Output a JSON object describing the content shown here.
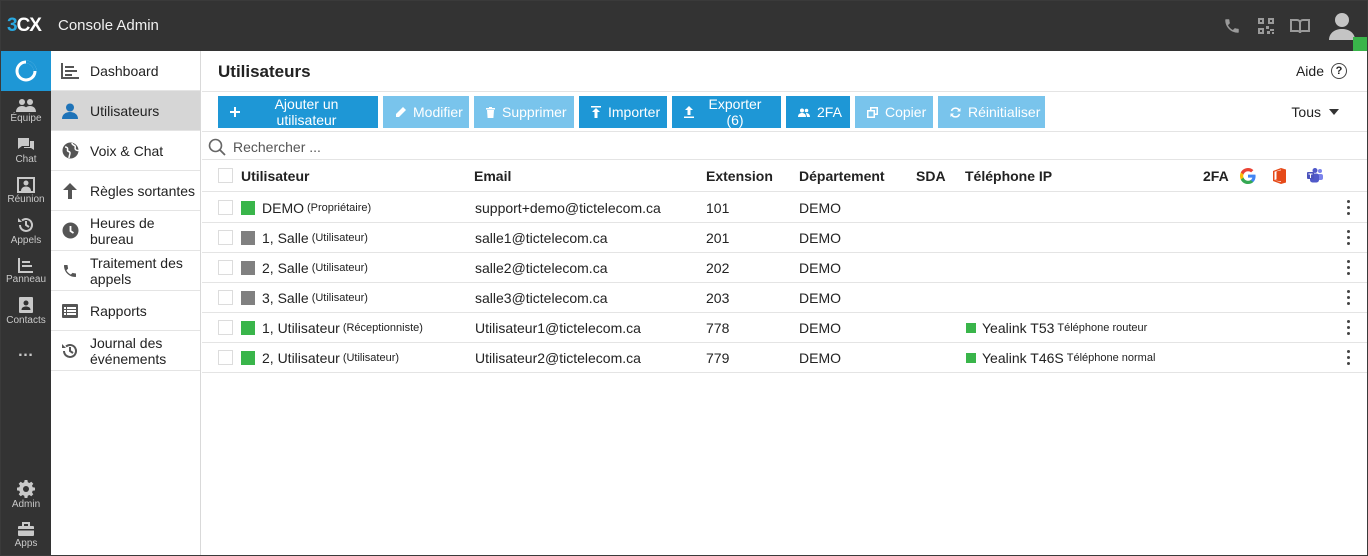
{
  "app": {
    "logo_part1": "3",
    "logo_part2": "CX",
    "title": "Console Admin"
  },
  "topbar_icons": [
    "phone-icon",
    "qr-code-icon",
    "book-icon",
    "user-avatar-icon"
  ],
  "rail": {
    "items": [
      {
        "label": "Équipe",
        "icon": "team-icon"
      },
      {
        "label": "Chat",
        "icon": "chat-icon"
      },
      {
        "label": "Réunion",
        "icon": "meeting-icon"
      },
      {
        "label": "Appels",
        "icon": "history-icon"
      },
      {
        "label": "Panneau",
        "icon": "panel-icon"
      },
      {
        "label": "Contacts",
        "icon": "contacts-icon"
      },
      {
        "label": "…",
        "icon": "more-icon"
      }
    ],
    "bottom": [
      {
        "label": "Admin",
        "icon": "gear-icon"
      },
      {
        "label": "Apps",
        "icon": "apps-icon"
      }
    ]
  },
  "menu": {
    "items": [
      {
        "label": "Dashboard",
        "icon": "dashboard-icon"
      },
      {
        "label": "Utilisateurs",
        "icon": "user-icon",
        "active": true
      },
      {
        "label": "Voix & Chat",
        "icon": "globe-icon"
      },
      {
        "label": "Règles sortantes",
        "icon": "arrow-up-icon"
      },
      {
        "label": "Heures de bureau",
        "icon": "clock-icon"
      },
      {
        "label": "Traitement des appels",
        "icon": "phone-icon"
      },
      {
        "label": "Rapports",
        "icon": "list-icon"
      },
      {
        "label": "Journal des événements",
        "icon": "history-icon"
      }
    ]
  },
  "main": {
    "title": "Utilisateurs",
    "help_label": "Aide",
    "help_glyph": "?",
    "toolbar": {
      "add": "Ajouter un utilisateur",
      "edit": "Modifier",
      "delete": "Supprimer",
      "import": "Importer",
      "export": "Exporter (6)",
      "twofa": "2FA",
      "copy": "Copier",
      "reset": "Réinitialiser"
    },
    "filter": "Tous",
    "search_placeholder": "Rechercher ...",
    "columns": {
      "user": "Utilisateur",
      "email": "Email",
      "extension": "Extension",
      "department": "Département",
      "sda": "SDA",
      "ip_phone": "Téléphone IP",
      "twofa": "2FA"
    },
    "integration_icons": [
      "google-icon",
      "office-icon",
      "teams-icon"
    ],
    "status_colors": {
      "online": "#39b54a",
      "offline": "#808080"
    },
    "rows": [
      {
        "name": "DEMO",
        "role": "(Propriétaire)",
        "status": "online",
        "email": "support+demo@tictelecom.ca",
        "extension": "101",
        "department": "DEMO",
        "sda": "",
        "phone_model": "",
        "phone_type": ""
      },
      {
        "name": "1, Salle",
        "role": "(Utilisateur)",
        "status": "offline",
        "email": "salle1@tictelecom.ca",
        "extension": "201",
        "department": "DEMO",
        "sda": "",
        "phone_model": "",
        "phone_type": ""
      },
      {
        "name": "2, Salle",
        "role": "(Utilisateur)",
        "status": "offline",
        "email": "salle2@tictelecom.ca",
        "extension": "202",
        "department": "DEMO",
        "sda": "",
        "phone_model": "",
        "phone_type": ""
      },
      {
        "name": "3, Salle",
        "role": "(Utilisateur)",
        "status": "offline",
        "email": "salle3@tictelecom.ca",
        "extension": "203",
        "department": "DEMO",
        "sda": "",
        "phone_model": "",
        "phone_type": ""
      },
      {
        "name": "1, Utilisateur",
        "role": "(Réceptionniste)",
        "status": "online",
        "email": "Utilisateur1@tictelecom.ca",
        "extension": "778",
        "department": "DEMO",
        "sda": "",
        "phone_model": "Yealink T53",
        "phone_type": "Téléphone routeur"
      },
      {
        "name": "2, Utilisateur",
        "role": "(Utilisateur)",
        "status": "online",
        "email": "Utilisateur2@tictelecom.ca",
        "extension": "779",
        "department": "DEMO",
        "sda": "",
        "phone_model": "Yealink T46S",
        "phone_type": "Téléphone normal"
      }
    ]
  }
}
